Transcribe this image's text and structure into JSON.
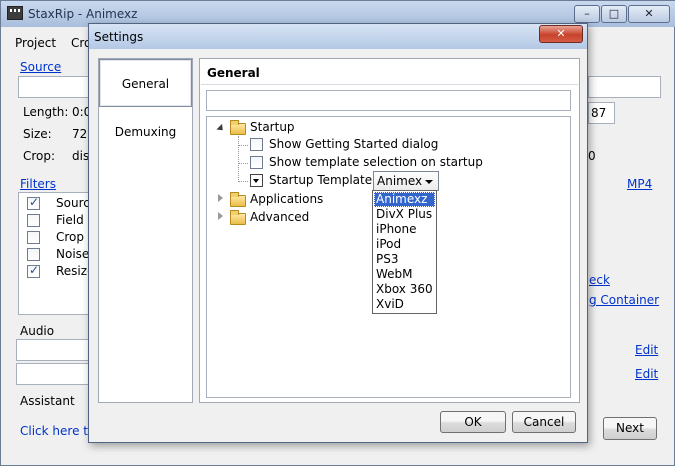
{
  "main": {
    "title": "StaxRip - Animexz",
    "menu": [
      "Project",
      "Cro"
    ],
    "source_link": "Source",
    "length_label": "Length:",
    "length_value": "0:0",
    "size_label": "Size:",
    "size_value": "720",
    "crop_label": "Crop:",
    "crop_value": "dis",
    "right_value_1": "87",
    "right_value_2": "0",
    "filters_link": "Filters",
    "mp4_link": "MP4",
    "filters": [
      {
        "label": "Source",
        "checked": true
      },
      {
        "label": "Field",
        "checked": false
      },
      {
        "label": "Crop",
        "checked": false
      },
      {
        "label": "Noise",
        "checked": false
      },
      {
        "label": "Resize",
        "checked": true
      }
    ],
    "right_link_1": "eck",
    "right_link_2": "g Container",
    "audio_label": "Audio",
    "edit_label": "Edit",
    "assistant_label": "Assistant",
    "assistant_link": "Click here to",
    "next_button": "Next",
    "win_buttons": [
      "–",
      "□",
      "✕"
    ]
  },
  "dialog": {
    "title": "Settings",
    "close": "✕",
    "nav": [
      "General",
      "Demuxing"
    ],
    "panel_heading": "General",
    "search_value": "",
    "tree": {
      "startup": "Startup",
      "show_getting_started": "Show Getting Started dialog",
      "show_template_selection": "Show template selection on startup",
      "startup_template_label": "Startup Template:",
      "startup_template_value": "Animex",
      "applications": "Applications",
      "advanced": "Advanced"
    },
    "dropdown_options": [
      "Animexz",
      "DivX Plus",
      "iPhone",
      "iPod",
      "PS3",
      "WebM",
      "Xbox 360",
      "XviD"
    ],
    "ok_button": "OK",
    "cancel_button": "Cancel"
  }
}
